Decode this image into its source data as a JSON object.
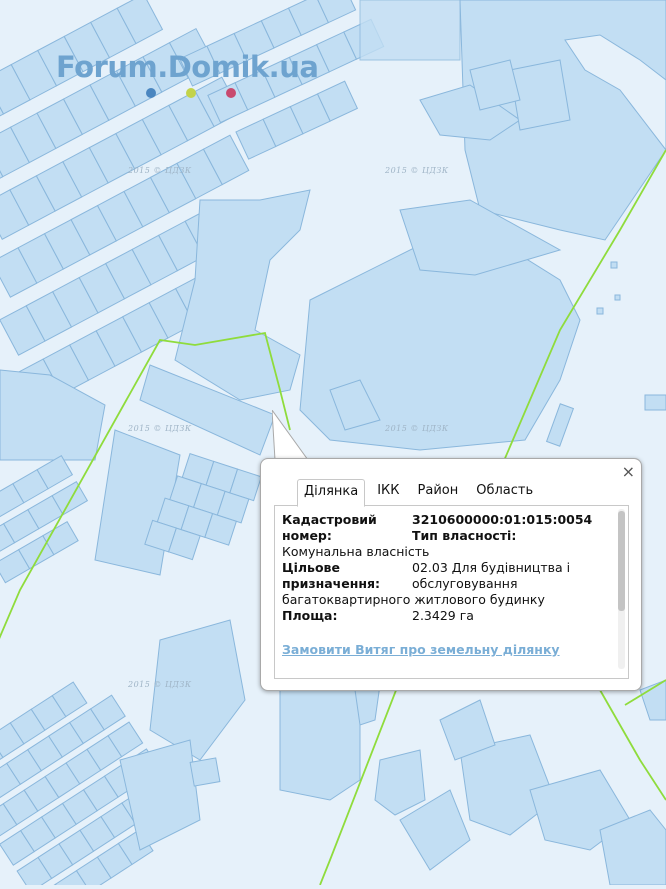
{
  "map": {
    "watermark": "Forum.Domik.ua",
    "logo_dot_colors": [
      "#4a86c0",
      "#c3d34a",
      "#c84a6f"
    ],
    "copyright": "2015 © ЦДЗК",
    "colors": {
      "background": "#e6f1fa",
      "parcel_fill": "#c2def3",
      "parcel_stroke": "#8ab7dc",
      "boundary": "#8fdc3c"
    }
  },
  "popup": {
    "close_icon": "×",
    "tabs": [
      {
        "label": "Ділянка",
        "active": true
      },
      {
        "label": "ІКК",
        "active": false
      },
      {
        "label": "Район",
        "active": false
      },
      {
        "label": "Область",
        "active": false
      }
    ],
    "fields": {
      "cadastral_label_1": "Кадастровий",
      "cadastral_label_2": "номер:",
      "cadastral_value": "3210600000:01:015:0054",
      "ownership_label": "Тип власності:",
      "ownership_value": "Комунальна власність",
      "purpose_label_1": "Цільове",
      "purpose_label_2": "призначення:",
      "purpose_value_1": "02.03 Для будівництва і",
      "purpose_value_2": "обслуговування",
      "purpose_value_3": "багатоквартирного житлового будинку",
      "area_label": "Площа:",
      "area_value": "2.3429 га"
    },
    "order_link": "Замовити Витяг про земельну ділянку"
  }
}
